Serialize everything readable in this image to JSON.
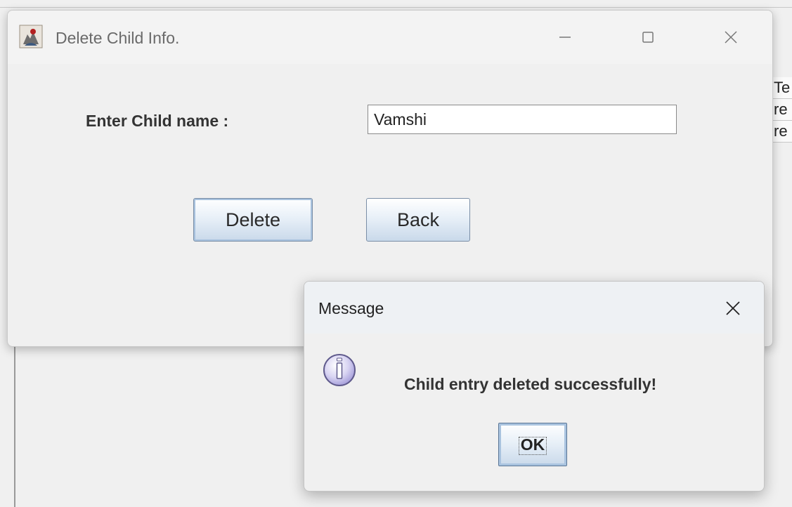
{
  "background_window": {
    "partial_rows": [
      "Te",
      "re",
      "re"
    ]
  },
  "main_window": {
    "title": "Delete Child Info.",
    "app_icon": "java-duke-icon",
    "controls": {
      "minimize_icon": "minimize-icon",
      "maximize_icon": "maximize-icon",
      "close_icon": "close-icon"
    },
    "form": {
      "child_name_label": "Enter Child name :",
      "child_name_value": "Vamshi"
    },
    "buttons": {
      "delete_label": "Delete",
      "back_label": "Back"
    }
  },
  "dialog": {
    "title": "Message",
    "close_icon": "close-icon",
    "icon": "information-icon",
    "message": "Child entry deleted successfully!",
    "ok_label": "OK"
  },
  "colors": {
    "button_gradient_top": "#ffffff",
    "button_gradient_bottom": "#c9d9ea",
    "info_icon_fill": "#d8d4f2",
    "info_icon_border": "#5f5a8c"
  }
}
